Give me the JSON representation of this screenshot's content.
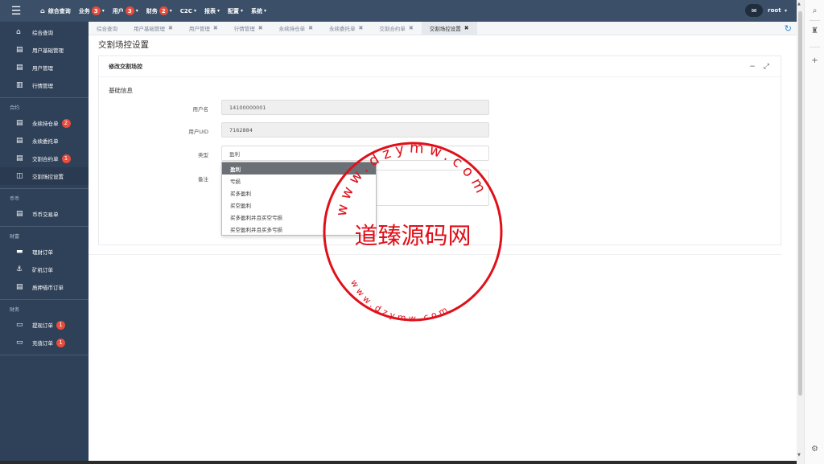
{
  "topbar": {
    "menu": [
      {
        "label": "综合查询",
        "home": true,
        "dropdown": false
      },
      {
        "label": "业务",
        "badge": "3",
        "dropdown": true
      },
      {
        "label": "用户",
        "badge": "3",
        "dropdown": true
      },
      {
        "label": "财务",
        "badge": "2",
        "dropdown": true
      },
      {
        "label": "C2C",
        "dropdown": true
      },
      {
        "label": "报表",
        "dropdown": true
      },
      {
        "label": "配置",
        "dropdown": true
      },
      {
        "label": "系统",
        "dropdown": true
      }
    ],
    "user": "root"
  },
  "sidebar": {
    "items": [
      {
        "label": "综合查询",
        "icon": "home-icon",
        "glyph": "⌂"
      },
      {
        "label": "用户基础管理",
        "icon": "file-icon",
        "glyph": "▤"
      },
      {
        "label": "用户管理",
        "icon": "file-icon",
        "glyph": "▤"
      },
      {
        "label": "行情管理",
        "icon": "bar-chart-icon",
        "glyph": "▥"
      }
    ],
    "groups": [
      {
        "title": "合约",
        "items": [
          {
            "label": "永续持仓单",
            "icon": "file-icon",
            "glyph": "▤",
            "badge": "2"
          },
          {
            "label": "永续委托单",
            "icon": "file-icon",
            "glyph": "▤"
          },
          {
            "label": "交割合约单",
            "icon": "file-icon",
            "glyph": "▤",
            "badge": "1"
          },
          {
            "label": "交割场控设置",
            "icon": "columns-icon",
            "glyph": "◫",
            "active": true
          }
        ]
      },
      {
        "title": "币币",
        "items": [
          {
            "label": "币币交易单",
            "icon": "file-icon",
            "glyph": "▤"
          }
        ]
      },
      {
        "title": "财富",
        "items": [
          {
            "label": "理财订单",
            "icon": "folder-icon",
            "glyph": "▬"
          },
          {
            "label": "矿机订单",
            "icon": "anchor-icon",
            "glyph": "⚓"
          },
          {
            "label": "质押借币订单",
            "icon": "file-icon",
            "glyph": "▤"
          }
        ]
      },
      {
        "title": "财务",
        "items": [
          {
            "label": "提现订单",
            "icon": "card-icon",
            "glyph": "▭",
            "badge": "1"
          },
          {
            "label": "充值订单",
            "icon": "card-icon",
            "glyph": "▭",
            "badge": "1"
          }
        ]
      }
    ]
  },
  "tabs": [
    {
      "label": "综合查询",
      "closable": false
    },
    {
      "label": "用户基础管理",
      "closable": true
    },
    {
      "label": "用户管理",
      "closable": true
    },
    {
      "label": "行情管理",
      "closable": true
    },
    {
      "label": "永续持仓单",
      "closable": true
    },
    {
      "label": "永续委托单",
      "closable": true
    },
    {
      "label": "交割合约单",
      "closable": true
    },
    {
      "label": "交割场控设置",
      "closable": true,
      "active": true
    }
  ],
  "page": {
    "title": "交割场控设置",
    "panel_title": "修改交割场控",
    "section_title": "基础信息",
    "fields": {
      "username_label": "用户名",
      "username_value": "14100000001",
      "uid_label": "用户UID",
      "uid_value": "7162884",
      "type_label": "类型",
      "type_value": "盈利",
      "remark_label": "备注"
    },
    "dropdown_options": [
      {
        "label": "盈利",
        "selected": true
      },
      {
        "label": "亏损"
      },
      {
        "label": "买多盈利"
      },
      {
        "label": "买空盈利"
      },
      {
        "label": "买多盈利并且买空亏损"
      },
      {
        "label": "买空盈利并且买多亏损"
      }
    ]
  },
  "watermark": {
    "top_arc": "www.dzymw.com",
    "center": "道臻源码网",
    "bottom_arc": "www.dzymw.com",
    "color": "#e0101a"
  }
}
